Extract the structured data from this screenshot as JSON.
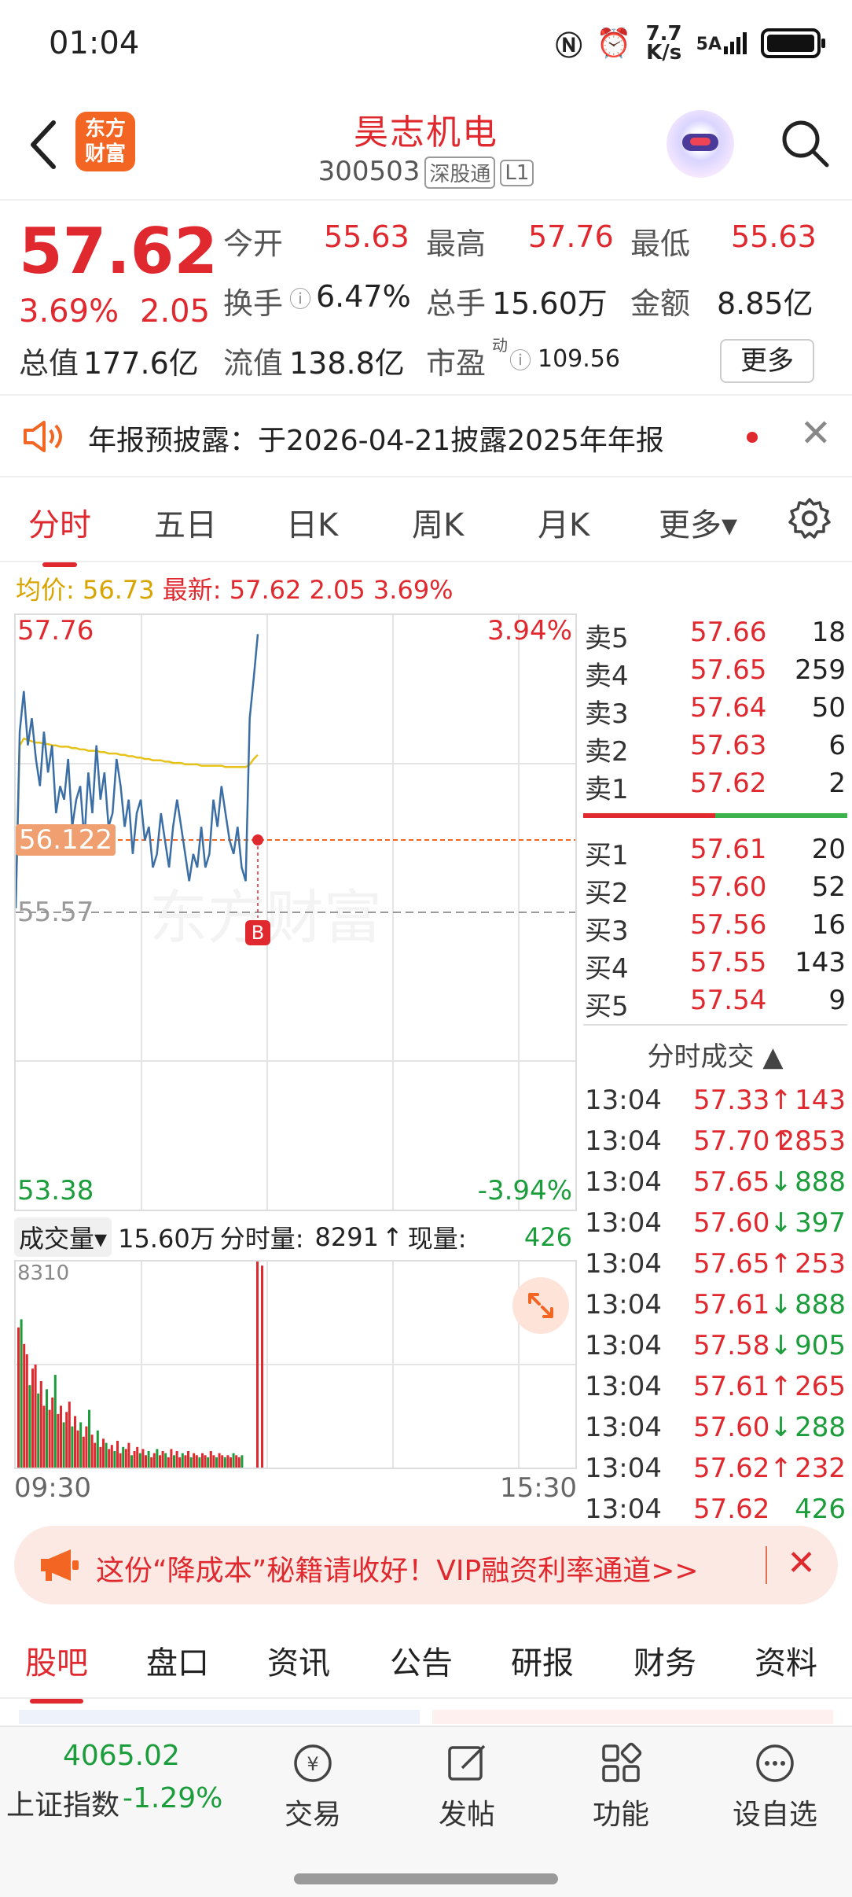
{
  "status": {
    "time": "01:04",
    "net_speed_top": "7.7",
    "net_speed_bottom": "K/s",
    "signal": "5A"
  },
  "header": {
    "logo_text": "东方财富",
    "stock_name": "昊志机电",
    "code": "300503",
    "tag1": "深股通",
    "tag2": "L1"
  },
  "quote": {
    "price": "57.62",
    "change_pct": "3.69%",
    "change": "2.05",
    "open_label": "今开",
    "open": "55.63",
    "high_label": "最高",
    "high": "57.76",
    "low_label": "最低",
    "low": "55.63",
    "turnover_label": "换手",
    "turnover": "6.47%",
    "volume_label": "总手",
    "volume": "15.60万",
    "amount_label": "金额",
    "amount": "8.85亿",
    "total_cap_label": "总值",
    "total_cap": "177.6亿",
    "float_cap_label": "流值",
    "float_cap": "138.8亿",
    "pe_label": "市盈",
    "pe_sup": "动",
    "pe": "109.56",
    "more": "更多"
  },
  "notice": {
    "text": "年报预披露：于2026-04-21披露2025年年报"
  },
  "tabs": [
    "分时",
    "五日",
    "日K",
    "周K",
    "月K",
    "更多▾"
  ],
  "avg": {
    "label": "均价:",
    "value": "56.73",
    "latest_label": "最新:",
    "latest": "57.62",
    "change": "2.05",
    "pct": "3.69%"
  },
  "chart": {
    "y_top": "57.76",
    "y_top_pct": "3.94%",
    "cursor_price": "56.122",
    "prev_close": "55.57",
    "y_bottom": "53.38",
    "y_bottom_pct": "-3.94%",
    "marker": "B",
    "watermark": "东方财富"
  },
  "chart_data": {
    "type": "line",
    "ylim": [
      53.38,
      57.76
    ],
    "series": [
      {
        "values": [
          55.6,
          56.9,
          57.2,
          56.8,
          57.0,
          56.7,
          56.5,
          56.9,
          56.6,
          56.8,
          56.3,
          56.5,
          56.4,
          56.7,
          56.2,
          56.4,
          56.5,
          56.1,
          56.6,
          56.3,
          56.8,
          56.4,
          56.6,
          56.2,
          56.3,
          56.7,
          56.5,
          56.2,
          56.4,
          56.0,
          56.3,
          56.4,
          56.1,
          56.2,
          55.9,
          56.0,
          56.3,
          56.1,
          55.9,
          56.2,
          56.4,
          56.2,
          56.0,
          55.8,
          56.0,
          55.9,
          56.2,
          55.9,
          56.0,
          56.4,
          56.2,
          56.5,
          56.3,
          56.1,
          56.0,
          56.2,
          55.9,
          55.8,
          57.0,
          57.3,
          57.62
        ]
      },
      {
        "values": [
          55.6,
          56.8,
          56.85,
          56.84,
          56.83,
          56.82,
          56.82,
          56.81,
          56.81,
          56.8,
          56.8,
          56.79,
          56.79,
          56.79,
          56.78,
          56.78,
          56.77,
          56.77,
          56.76,
          56.76,
          56.76,
          56.75,
          56.75,
          56.74,
          56.74,
          56.74,
          56.73,
          56.73,
          56.72,
          56.72,
          56.71,
          56.71,
          56.7,
          56.7,
          56.69,
          56.69,
          56.69,
          56.68,
          56.68,
          56.67,
          56.67,
          56.67,
          56.66,
          56.66,
          56.66,
          56.66,
          56.65,
          56.65,
          56.65,
          56.65,
          56.65,
          56.65,
          56.64,
          56.64,
          56.64,
          56.64,
          56.64,
          56.64,
          56.66,
          56.7,
          56.73
        ]
      }
    ]
  },
  "volume": {
    "dropdown": "成交量▾",
    "total": "15.60万",
    "period_label": "分时量:",
    "period_value": "8291",
    "now_label": "现量:",
    "now_value": "426",
    "max": "8310",
    "time_start": "09:30",
    "time_end": "15:30"
  },
  "book": {
    "asks": [
      {
        "label": "卖5",
        "price": "57.66",
        "vol": "18"
      },
      {
        "label": "卖4",
        "price": "57.65",
        "vol": "259"
      },
      {
        "label": "卖3",
        "price": "57.64",
        "vol": "50"
      },
      {
        "label": "卖2",
        "price": "57.63",
        "vol": "6"
      },
      {
        "label": "卖1",
        "price": "57.62",
        "vol": "2"
      }
    ],
    "bids": [
      {
        "label": "买1",
        "price": "57.61",
        "vol": "20"
      },
      {
        "label": "买2",
        "price": "57.60",
        "vol": "52"
      },
      {
        "label": "买3",
        "price": "57.56",
        "vol": "16"
      },
      {
        "label": "买4",
        "price": "57.55",
        "vol": "143"
      },
      {
        "label": "买5",
        "price": "57.54",
        "vol": "9"
      }
    ],
    "ticks_header": "分时成交 ▲",
    "ticks": [
      {
        "time": "13:04",
        "price": "57.33↑",
        "vol": "143",
        "dir": "up"
      },
      {
        "time": "13:04",
        "price": "57.70↑",
        "vol": "2853",
        "dir": "up"
      },
      {
        "time": "13:04",
        "price": "57.65↓",
        "vol": "888",
        "dir": "down"
      },
      {
        "time": "13:04",
        "price": "57.60↓",
        "vol": "397",
        "dir": "down"
      },
      {
        "time": "13:04",
        "price": "57.65↑",
        "vol": "253",
        "dir": "up"
      },
      {
        "time": "13:04",
        "price": "57.61↓",
        "vol": "888",
        "dir": "down"
      },
      {
        "time": "13:04",
        "price": "57.58↓",
        "vol": "905",
        "dir": "down"
      },
      {
        "time": "13:04",
        "price": "57.61↑",
        "vol": "265",
        "dir": "up"
      },
      {
        "time": "13:04",
        "price": "57.60↓",
        "vol": "288",
        "dir": "down"
      },
      {
        "time": "13:04",
        "price": "57.62↑",
        "vol": "232",
        "dir": "up"
      },
      {
        "time": "13:04",
        "price": "57.62",
        "vol": "426",
        "dir": "flat"
      }
    ]
  },
  "promo": {
    "text": "这份“降成本”秘籍请收好！VIP融资利率通道>>"
  },
  "bottom_tabs": [
    "股吧",
    "盘口",
    "资讯",
    "公告",
    "研报",
    "财务",
    "资料"
  ],
  "bottom_bar": {
    "index_value": "4065.02",
    "index_name": "上证指数",
    "index_pct": "-1.29%",
    "trade": "交易",
    "post": "发帖",
    "func": "功能",
    "watch": "设自选"
  },
  "colors": {
    "up": "#e0282f",
    "down": "#1a9d3a",
    "price_line": "#3a6ea5",
    "avg_line": "#e6c21a"
  }
}
